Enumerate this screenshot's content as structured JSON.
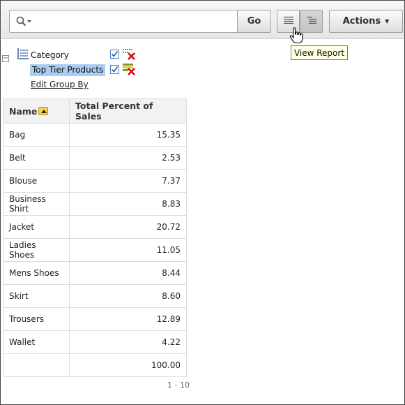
{
  "search": {
    "value": "",
    "placeholder": ""
  },
  "toolbar": {
    "go_label": "Go",
    "actions_label": "Actions",
    "view_report_icon": "view-report-icon",
    "view_groupby_icon": "view-group-by-icon"
  },
  "tooltip": {
    "text": "View Report"
  },
  "filters": {
    "group_by_column": "Category",
    "highlight": "Top Tier Products",
    "edit_group_by": "Edit Group By"
  },
  "table": {
    "columns": [
      "Name",
      "Total Percent of Sales"
    ],
    "rows": [
      {
        "name": "Bag",
        "pct": "15.35"
      },
      {
        "name": "Belt",
        "pct": "2.53"
      },
      {
        "name": "Blouse",
        "pct": "7.37"
      },
      {
        "name": "Business Shirt",
        "pct": "8.83"
      },
      {
        "name": "Jacket",
        "pct": "20.72"
      },
      {
        "name": "Ladies Shoes",
        "pct": "11.05"
      },
      {
        "name": "Mens Shoes",
        "pct": "8.44"
      },
      {
        "name": "Skirt",
        "pct": "8.60"
      },
      {
        "name": "Trousers",
        "pct": "12.89"
      },
      {
        "name": "Wallet",
        "pct": "4.22"
      }
    ],
    "total": {
      "name": "",
      "pct": "100.00"
    }
  },
  "pagination": "1 - 10",
  "colors": {
    "highlight_bg": "#a9cdf3",
    "tooltip_bg": "#ffffe1",
    "sort_icon": "#f7d64e",
    "delete_red": "#d40000"
  }
}
